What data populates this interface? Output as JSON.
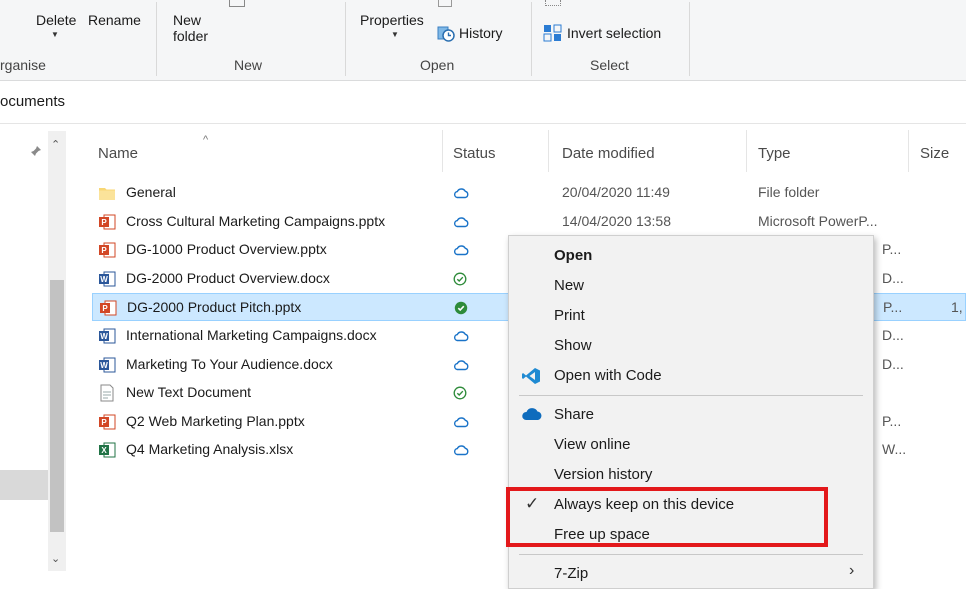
{
  "ribbon": {
    "delete": "Delete",
    "rename": "Rename",
    "new_folder_line1": "New",
    "new_folder_line2": "folder",
    "properties": "Properties",
    "history": "History",
    "invert_selection": "Invert selection",
    "groups": {
      "organise": "rganise",
      "new": "New",
      "open": "Open",
      "select": "Select"
    }
  },
  "address": {
    "path": "ocuments"
  },
  "columns": {
    "name": "Name",
    "status": "Status",
    "date": "Date modified",
    "type": "Type",
    "size": "Size"
  },
  "files": [
    {
      "icon": "folder-icon",
      "name": "General",
      "status": "cloud",
      "date": "20/04/2020 11:49",
      "type": "File folder",
      "size": ""
    },
    {
      "icon": "powerpoint-icon",
      "name": "Cross Cultural Marketing Campaigns.pptx",
      "status": "cloud",
      "date": "14/04/2020 13:58",
      "type": "Microsoft PowerP...",
      "size": ""
    },
    {
      "icon": "powerpoint-icon",
      "name": "DG-1000 Product Overview.pptx",
      "status": "cloud",
      "date": "",
      "type": "P...",
      "size": ""
    },
    {
      "icon": "word-icon",
      "name": "DG-2000 Product Overview.docx",
      "status": "available",
      "date": "",
      "type": "D...",
      "size": ""
    },
    {
      "icon": "powerpoint-icon",
      "name": "DG-2000 Product Pitch.pptx",
      "status": "always",
      "date": "",
      "type": "P...",
      "size": "1,",
      "selected": true
    },
    {
      "icon": "word-icon",
      "name": "International Marketing Campaigns.docx",
      "status": "cloud",
      "date": "",
      "type": "D...",
      "size": ""
    },
    {
      "icon": "word-icon",
      "name": "Marketing To Your Audience.docx",
      "status": "cloud",
      "date": "",
      "type": "D...",
      "size": ""
    },
    {
      "icon": "text-file-icon",
      "name": "New Text Document",
      "status": "available",
      "date": "",
      "type": "",
      "size": ""
    },
    {
      "icon": "powerpoint-icon",
      "name": "Q2 Web Marketing Plan.pptx",
      "status": "cloud",
      "date": "",
      "type": "P...",
      "size": ""
    },
    {
      "icon": "excel-icon",
      "name": "Q4 Marketing Analysis.xlsx",
      "status": "cloud",
      "date": "",
      "type": "W...",
      "size": ""
    }
  ],
  "context_menu": {
    "open": "Open",
    "new": "New",
    "print": "Print",
    "show": "Show",
    "open_with_code": "Open with Code",
    "share": "Share",
    "view_online": "View online",
    "version_history": "Version history",
    "always_keep": "Always keep on this device",
    "free_up_space": "Free up space",
    "seven_zip": "7-Zip"
  },
  "colors": {
    "selected_row": "#cce8ff",
    "cloud_icon": "#1a73c8",
    "available_icon": "#2e8b3a",
    "highlight_box": "#e3181b"
  }
}
